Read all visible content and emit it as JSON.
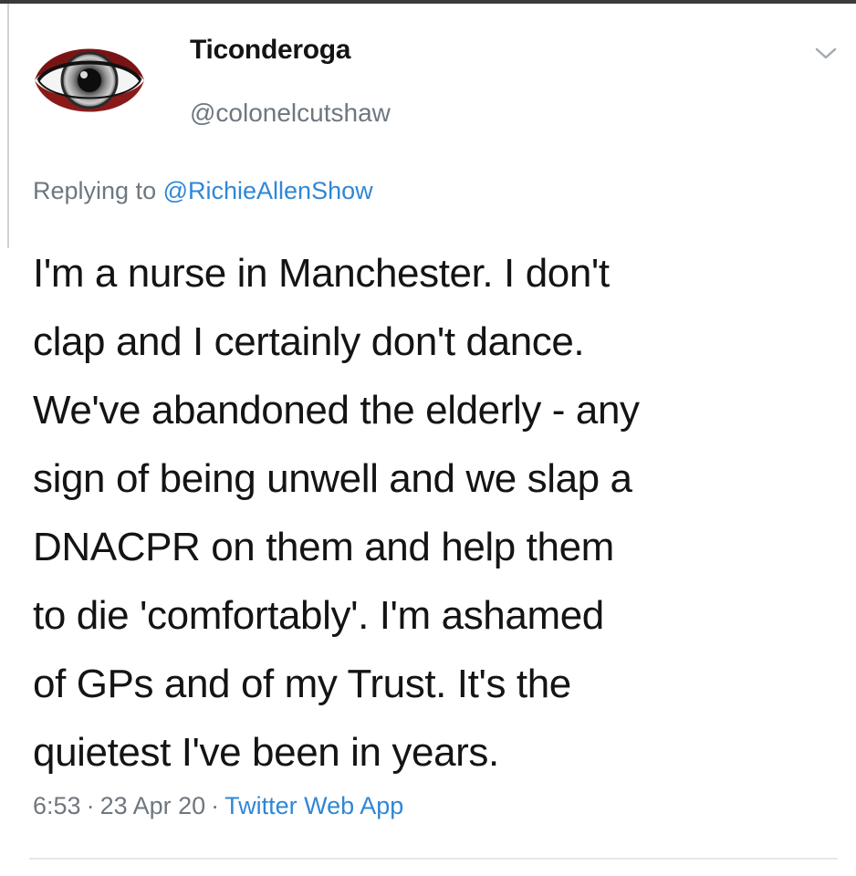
{
  "tweet": {
    "author": {
      "display_name": "Ticonderoga",
      "handle": "@colonelcutshaw",
      "avatar_icon": "eye-icon"
    },
    "menu_icon": "chevron-down-icon",
    "reply": {
      "prefix": "Replying to ",
      "mention": "@RichieAllenShow"
    },
    "body_lines": [
      "I'm a nurse in Manchester. I don't",
      "clap and I certainly don't dance.",
      "We've abandoned the elderly - any",
      "sign of being unwell and we slap a",
      "DNACPR on them and help them",
      "to die 'comfortably'. I'm ashamed",
      "of GPs and of my Trust. It's the",
      "quietest I've been in years."
    ],
    "meta": {
      "time": "6:53",
      "separator": "·",
      "date": "23 Apr 20",
      "source": "Twitter Web App"
    }
  },
  "colors": {
    "text": "#141414",
    "muted": "#6e7780",
    "link": "#2f87d6",
    "avatar_rim": "#8a1a1a"
  }
}
